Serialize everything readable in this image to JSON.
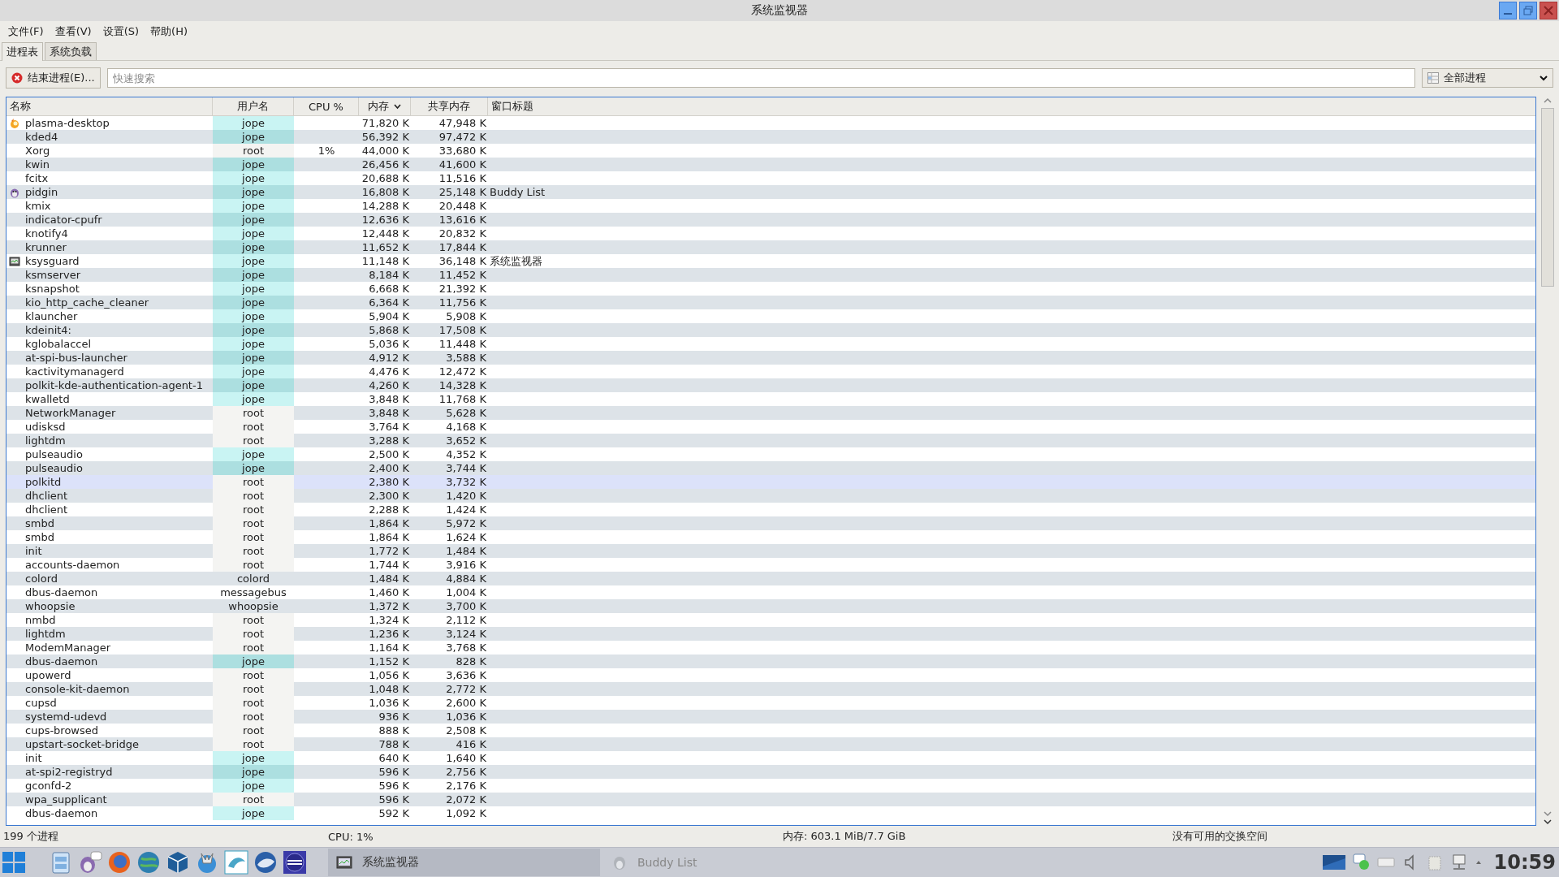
{
  "window": {
    "title": "系统监视器"
  },
  "menu": [
    "文件(F)",
    "查看(V)",
    "设置(S)",
    "帮助(H)"
  ],
  "tabs": [
    {
      "label": "进程表",
      "selected": true
    },
    {
      "label": "系统负载",
      "selected": false
    }
  ],
  "toolbar": {
    "end_button": "结束进程(E)...",
    "search": {
      "placeholder": "快速搜索"
    },
    "filter": "全部进程"
  },
  "table": {
    "columns": [
      {
        "label": "名称",
        "sorted": false
      },
      {
        "label": "用户名",
        "sorted": false
      },
      {
        "label": "CPU %",
        "sorted": false
      },
      {
        "label": "内存",
        "sorted": true
      },
      {
        "label": "共享内存",
        "sorted": false
      },
      {
        "label": "窗口标题",
        "sorted": false
      }
    ],
    "rows": [
      {
        "kind": "desktop",
        "name": "plasma-desktop",
        "user": "jope",
        "color": "#c9f4f3",
        "memory": "71,820 K",
        "shared": "47,948 K",
        "selected": false
      },
      {
        "kind": "process",
        "name": "kded4",
        "user": "jope",
        "color": "#acdfe0",
        "memory": "56,392 K",
        "shared": "97,472 K",
        "selected": false
      },
      {
        "kind": "process",
        "name": "Xorg",
        "user": "root",
        "color": "#f4f4f2",
        "cpu": "1%",
        "memory": "44,000 K",
        "shared": "33,680 K",
        "selected": false
      },
      {
        "kind": "process",
        "name": "kwin",
        "user": "jope",
        "color": "#acdfe0",
        "memory": "26,456 K",
        "shared": "41,600 K",
        "selected": false
      },
      {
        "kind": "process",
        "name": "fcitx",
        "user": "jope",
        "color": "#c9f4f3",
        "memory": "20,688 K",
        "shared": "11,516 K",
        "selected": false
      },
      {
        "kind": "chat",
        "name": "pidgin",
        "user": "jope",
        "color": "#acdfe0",
        "memory": "16,808 K",
        "shared": "25,148 K",
        "window_title": "Buddy List",
        "selected": false
      },
      {
        "kind": "process",
        "name": "kmix",
        "user": "jope",
        "color": "#c9f4f3",
        "memory": "14,288 K",
        "shared": "20,448 K",
        "selected": false
      },
      {
        "kind": "process",
        "name": "indicator-cpufr",
        "user": "jope",
        "color": "#acdfe0",
        "memory": "12,636 K",
        "shared": "13,616 K",
        "selected": false
      },
      {
        "kind": "process",
        "name": "knotify4",
        "user": "jope",
        "color": "#c9f4f3",
        "memory": "12,448 K",
        "shared": "20,832 K",
        "selected": false
      },
      {
        "kind": "process",
        "name": "krunner",
        "user": "jope",
        "color": "#acdfe0",
        "memory": "11,652 K",
        "shared": "17,844 K",
        "selected": false
      },
      {
        "kind": "monitor",
        "name": "ksysguard",
        "user": "jope",
        "color": "#c9f4f3",
        "memory": "11,148 K",
        "shared": "36,148 K",
        "window_title": "系统监视器",
        "selected": false
      },
      {
        "kind": "process",
        "name": "ksmserver",
        "user": "jope",
        "color": "#acdfe0",
        "memory": "8,184 K",
        "shared": "11,452 K",
        "selected": false
      },
      {
        "kind": "process",
        "name": "ksnapshot",
        "user": "jope",
        "color": "#c9f4f3",
        "memory": "6,668 K",
        "shared": "21,392 K",
        "selected": false
      },
      {
        "kind": "process",
        "name": "kio_http_cache_cleaner",
        "user": "jope",
        "color": "#acdfe0",
        "memory": "6,364 K",
        "shared": "11,756 K",
        "selected": false
      },
      {
        "kind": "process",
        "name": "klauncher",
        "user": "jope",
        "color": "#c9f4f3",
        "memory": "5,904 K",
        "shared": "5,908 K",
        "selected": false
      },
      {
        "kind": "process",
        "name": "kdeinit4:",
        "user": "jope",
        "color": "#acdfe0",
        "memory": "5,868 K",
        "shared": "17,508 K",
        "selected": false
      },
      {
        "kind": "process",
        "name": "kglobalaccel",
        "user": "jope",
        "color": "#c9f4f3",
        "memory": "5,036 K",
        "shared": "11,448 K",
        "selected": false
      },
      {
        "kind": "process",
        "name": "at-spi-bus-launcher",
        "user": "jope",
        "color": "#acdfe0",
        "memory": "4,912 K",
        "shared": "3,588 K",
        "selected": false
      },
      {
        "kind": "process",
        "name": "kactivitymanagerd",
        "user": "jope",
        "color": "#c9f4f3",
        "memory": "4,476 K",
        "shared": "12,472 K",
        "selected": false
      },
      {
        "kind": "process",
        "name": "polkit-kde-authentication-agent-1",
        "user": "jope",
        "color": "#acdfe0",
        "memory": "4,260 K",
        "shared": "14,328 K",
        "selected": false
      },
      {
        "kind": "process",
        "name": "kwalletd",
        "user": "jope",
        "color": "#c9f4f3",
        "memory": "3,848 K",
        "shared": "11,768 K",
        "selected": false
      },
      {
        "kind": "process",
        "name": "NetworkManager",
        "user": "root",
        "color": "#f4f4f2",
        "memory": "3,848 K",
        "shared": "5,628 K",
        "selected": false
      },
      {
        "kind": "process",
        "name": "udisksd",
        "user": "root",
        "color": "#f4f4f2",
        "memory": "3,764 K",
        "shared": "4,168 K",
        "selected": false
      },
      {
        "kind": "process",
        "name": "lightdm",
        "user": "root",
        "color": "#f4f4f2",
        "memory": "3,288 K",
        "shared": "3,652 K",
        "selected": false
      },
      {
        "kind": "process",
        "name": "pulseaudio",
        "user": "jope",
        "color": "#c9f4f3",
        "memory": "2,500 K",
        "shared": "4,352 K",
        "selected": false
      },
      {
        "kind": "process",
        "name": "pulseaudio",
        "user": "jope",
        "color": "#acdfe0",
        "memory": "2,400 K",
        "shared": "3,744 K",
        "selected": false
      },
      {
        "kind": "process",
        "name": "polkitd",
        "user": "root",
        "color": "#f4f4f2",
        "memory": "2,380 K",
        "shared": "3,732 K",
        "selected": true
      },
      {
        "kind": "process",
        "name": "dhclient",
        "user": "root",
        "color": "#f4f4f2",
        "memory": "2,300 K",
        "shared": "1,420 K",
        "selected": false
      },
      {
        "kind": "process",
        "name": "dhclient",
        "user": "root",
        "color": "#f4f4f2",
        "memory": "2,288 K",
        "shared": "1,424 K",
        "selected": false
      },
      {
        "kind": "process",
        "name": "smbd",
        "user": "root",
        "color": "#f4f4f2",
        "memory": "1,864 K",
        "shared": "5,972 K",
        "selected": false
      },
      {
        "kind": "process",
        "name": "smbd",
        "user": "root",
        "color": "#f4f4f2",
        "memory": "1,864 K",
        "shared": "1,624 K",
        "selected": false
      },
      {
        "kind": "process",
        "name": "init",
        "user": "root",
        "color": "#f4f4f2",
        "memory": "1,772 K",
        "shared": "1,484 K",
        "selected": false
      },
      {
        "kind": "process",
        "name": "accounts-daemon",
        "user": "root",
        "color": "#f4f4f2",
        "memory": "1,744 K",
        "shared": "3,916 K",
        "selected": false
      },
      {
        "kind": "process",
        "name": "colord",
        "user": "colord",
        "memory": "1,484 K",
        "shared": "4,884 K",
        "selected": false
      },
      {
        "kind": "process",
        "name": "dbus-daemon",
        "user": "messagebus",
        "memory": "1,460 K",
        "shared": "1,004 K",
        "selected": false
      },
      {
        "kind": "process",
        "name": "whoopsie",
        "user": "whoopsie",
        "memory": "1,372 K",
        "shared": "3,700 K",
        "selected": false
      },
      {
        "kind": "process",
        "name": "nmbd",
        "user": "root",
        "color": "#f4f4f2",
        "memory": "1,324 K",
        "shared": "2,112 K",
        "selected": false
      },
      {
        "kind": "process",
        "name": "lightdm",
        "user": "root",
        "color": "#f4f4f2",
        "memory": "1,236 K",
        "shared": "3,124 K",
        "selected": false
      },
      {
        "kind": "process",
        "name": "ModemManager",
        "user": "root",
        "color": "#f4f4f2",
        "memory": "1,164 K",
        "shared": "3,768 K",
        "selected": false
      },
      {
        "kind": "process",
        "name": "dbus-daemon",
        "user": "jope",
        "color": "#acdfe0",
        "memory": "1,152 K",
        "shared": "828 K",
        "selected": false
      },
      {
        "kind": "process",
        "name": "upowerd",
        "user": "root",
        "color": "#f4f4f2",
        "memory": "1,056 K",
        "shared": "3,636 K",
        "selected": false
      },
      {
        "kind": "process",
        "name": "console-kit-daemon",
        "user": "root",
        "color": "#f4f4f2",
        "memory": "1,048 K",
        "shared": "2,772 K",
        "selected": false
      },
      {
        "kind": "process",
        "name": "cupsd",
        "user": "root",
        "color": "#f4f4f2",
        "memory": "1,036 K",
        "shared": "2,600 K",
        "selected": false
      },
      {
        "kind": "process",
        "name": "systemd-udevd",
        "user": "root",
        "color": "#f4f4f2",
        "memory": "936 K",
        "shared": "1,036 K",
        "selected": false
      },
      {
        "kind": "process",
        "name": "cups-browsed",
        "user": "root",
        "color": "#f4f4f2",
        "memory": "888 K",
        "shared": "2,508 K",
        "selected": false
      },
      {
        "kind": "process",
        "name": "upstart-socket-bridge",
        "user": "root",
        "color": "#f4f4f2",
        "memory": "788 K",
        "shared": "416 K",
        "selected": false
      },
      {
        "kind": "process",
        "name": "init",
        "user": "jope",
        "color": "#c9f4f3",
        "memory": "640 K",
        "shared": "1,640 K",
        "selected": false
      },
      {
        "kind": "process",
        "name": "at-spi2-registryd",
        "user": "jope",
        "color": "#acdfe0",
        "memory": "596 K",
        "shared": "2,756 K",
        "selected": false
      },
      {
        "kind": "process",
        "name": "gconfd-2",
        "user": "jope",
        "color": "#c9f4f3",
        "memory": "596 K",
        "shared": "2,176 K",
        "selected": false
      },
      {
        "kind": "process",
        "name": "wpa_supplicant",
        "user": "root",
        "color": "#f4f4f2",
        "memory": "596 K",
        "shared": "2,072 K",
        "selected": false
      },
      {
        "kind": "process",
        "name": "dbus-daemon",
        "user": "jope",
        "color": "#c9f4f3",
        "memory": "592 K",
        "shared": "1,092 K",
        "selected": false
      }
    ]
  },
  "status_bar": {
    "processes": "199 个进程",
    "cpu": "CPU: 1%",
    "memory": "内存: 603.1 MiB/7.7 GiB",
    "swap": "没有可用的交换空间"
  },
  "taskbar": {
    "tasks": [
      {
        "label": "系统监视器",
        "kind": "monitor",
        "selected": true
      },
      {
        "label": "Buddy List",
        "kind": "chat",
        "selected": false
      }
    ],
    "clock": "10:59"
  }
}
